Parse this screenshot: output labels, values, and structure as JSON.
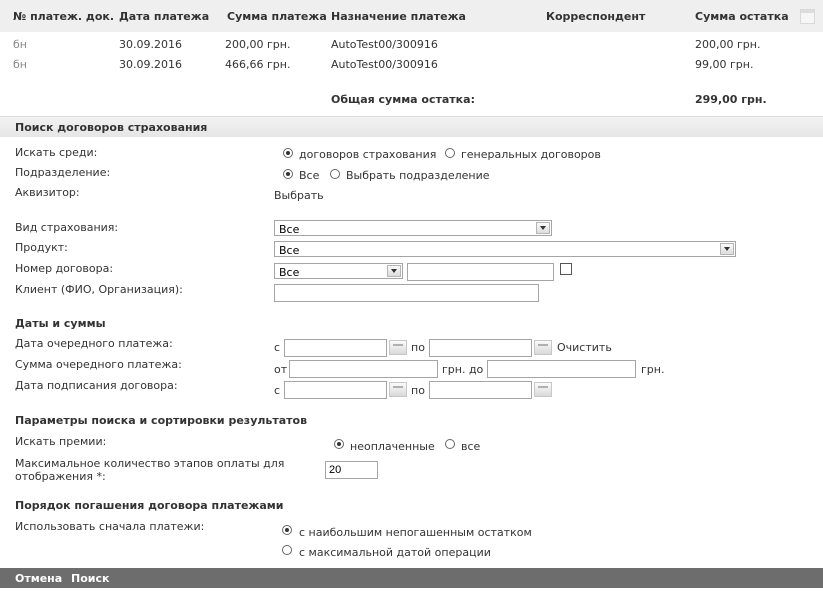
{
  "payments": {
    "headers": [
      "№ платеж. док.",
      "Дата платежа",
      "Сумма платежа",
      "Назначение платежа",
      "Корреспондент",
      "Сумма остатка"
    ],
    "rows": [
      {
        "doc": "бн",
        "date": "30.09.2016",
        "amount": "200,00 грн.",
        "purpose": "AutoTest00/300916",
        "correspondent": "",
        "remaining": "200,00 грн."
      },
      {
        "doc": "бн",
        "date": "30.09.2016",
        "amount": "466,66 грн.",
        "purpose": "AutoTest00/300916",
        "correspondent": "",
        "remaining": "99,00 грн."
      }
    ],
    "total_label": "Общая сумма остатка:",
    "total_value": "299,00 грн."
  },
  "search": {
    "title": "Поиск договоров страхования",
    "search_among_label": "Искать среди:",
    "search_among_options": [
      "договоров страхования",
      "генеральных договоров"
    ],
    "subdivision_label": "Подразделение:",
    "subdivision_options": [
      "Все",
      "Выбрать подразделение"
    ],
    "acquirer_label": "Аквизитор:",
    "acquirer_link": "Выбрать",
    "insurance_type_label": "Вид страхования:",
    "insurance_type_value": "Все",
    "product_label": "Продукт:",
    "product_value": "Все",
    "contract_no_label": "Номер договора:",
    "contract_no_select": "Все",
    "contract_no_value": "",
    "client_label": "Клиент (ФИО, Организация):",
    "client_value": ""
  },
  "dates": {
    "title": "Даты и суммы",
    "next_payment_date_label": "Дата очередного платежа:",
    "from_label": "с",
    "to_label": "по",
    "clear_link": "Очистить",
    "next_payment_sum_label": "Сумма очередного платежа:",
    "sum_from_label": "от",
    "sum_to_label": "грн. до",
    "currency": "грн.",
    "signing_date_label": "Дата подписания договора:"
  },
  "params": {
    "title": "Параметры поиска и сортировки результатов",
    "premiums_label": "Искать премии:",
    "premiums_options": [
      "неоплаченные",
      "все"
    ],
    "max_stages_label_line1": "Максимальное количество этапов оплаты для",
    "max_stages_label_line2": "отображения *:",
    "max_stages_value": "20"
  },
  "order": {
    "title": "Порядок погашения договора платежами",
    "use_first_label": "Использовать сначала платежи:",
    "options": [
      "с наибольшим непогашенным остатком",
      "с максимальной датой операции"
    ]
  },
  "footer": {
    "cancel": "Отмена",
    "search": "Поиск"
  }
}
